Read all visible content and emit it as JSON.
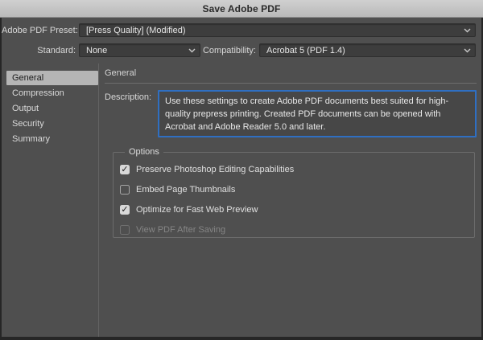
{
  "window": {
    "title": "Save Adobe PDF"
  },
  "preset_row": {
    "label": "Adobe PDF Preset:",
    "value": "[Press Quality] (Modified)"
  },
  "standard_row": {
    "label": "Standard:",
    "value": "None"
  },
  "compatibility_row": {
    "label": "Compatibility:",
    "value": "Acrobat 5 (PDF 1.4)"
  },
  "sidebar": {
    "items": [
      {
        "label": "General",
        "selected": true
      },
      {
        "label": "Compression",
        "selected": false
      },
      {
        "label": "Output",
        "selected": false
      },
      {
        "label": "Security",
        "selected": false
      },
      {
        "label": "Summary",
        "selected": false
      }
    ]
  },
  "main": {
    "section_title": "General",
    "description": {
      "label": "Description:",
      "text": "Use these settings to create Adobe PDF documents best suited for high-quality prepress printing.  Created PDF documents can be opened with Acrobat and Adobe Reader 5.0 and later."
    },
    "options": {
      "legend": "Options",
      "checkboxes": [
        {
          "label": "Preserve Photoshop Editing Capabilities",
          "checked": true,
          "disabled": false
        },
        {
          "label": "Embed Page Thumbnails",
          "checked": false,
          "disabled": false
        },
        {
          "label": "Optimize for Fast Web Preview",
          "checked": true,
          "disabled": false
        },
        {
          "label": "View PDF After Saving",
          "checked": false,
          "disabled": true
        }
      ]
    }
  },
  "icons": {
    "checkmark_glyph": "✓",
    "dropdown_chevron": "chevron-down"
  },
  "colors": {
    "dialog_bg": "#4f4f4f",
    "titlebar_bg": "#c8c8c8",
    "field_bg": "#3d3d3d",
    "focus_border": "#2f6fc2",
    "selected_item_bg": "#b5b5b5",
    "text": "#e0e0e0",
    "disabled_text": "#858585",
    "window_frame": "#262626"
  }
}
